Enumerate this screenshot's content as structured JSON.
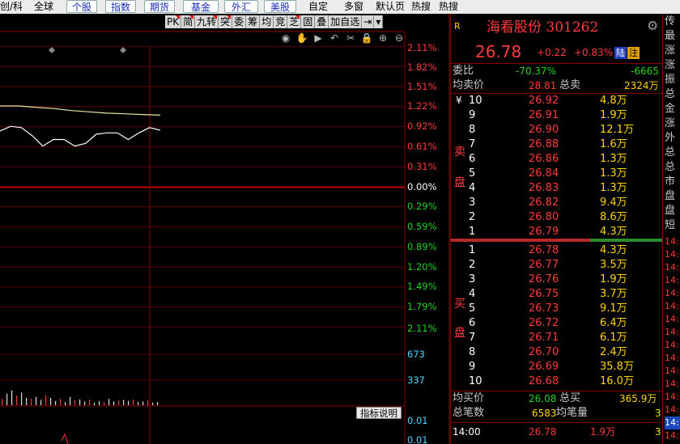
{
  "top_menu": {
    "items": [
      "创/科",
      "全球",
      "个股",
      "指数",
      "期货",
      "基金",
      "外汇",
      "美股",
      "自定",
      "多窗",
      "默认页",
      "热搜",
      "热搜"
    ],
    "buttons": [
      "个股",
      "指数",
      "期货",
      "基金",
      "外汇",
      "美股"
    ]
  },
  "chart_toolbar": [
    "PK",
    "简",
    "九转",
    "突",
    "委",
    "筹",
    "均",
    "竞",
    "芝",
    "固",
    "叠",
    "加自选",
    "⇥",
    "▾"
  ],
  "chart_tools": [
    "eye-icon",
    "hand-icon",
    "play-icon",
    "undo-icon",
    "scissors-icon",
    "lock-icon",
    "zoom-in-icon",
    "zoom-out-icon"
  ],
  "chart_data": {
    "type": "line",
    "price_axis_labels_up": [
      "2.11%",
      "1.82%",
      "1.51%",
      "1.22%",
      "0.92%",
      "0.61%",
      "0.31%"
    ],
    "price_axis_zero": "0.00%",
    "price_axis_labels_down": [
      "0.29%",
      "0.59%",
      "0.89%",
      "1.20%",
      "1.49%",
      "1.79%",
      "2.11%"
    ],
    "volume_labels": [
      "673",
      "337"
    ],
    "indicator_labels": [
      "0.01",
      "0.01"
    ],
    "indicator_button": "指标说明",
    "avg_line": [
      1.23,
      1.23,
      1.21,
      1.19,
      1.16,
      1.14,
      1.12,
      1.11,
      1.1,
      1.09
    ],
    "price_line": [
      0.85,
      0.92,
      0.9,
      0.78,
      0.62,
      0.72,
      0.72,
      0.62,
      0.66,
      0.8,
      0.82,
      0.82,
      0.72,
      0.82,
      0.9,
      0.86
    ],
    "volumes": [
      60,
      110,
      140,
      90,
      120,
      70,
      60,
      80,
      50,
      95,
      70,
      40,
      60,
      30,
      80,
      45,
      55,
      35,
      50,
      25,
      40,
      30,
      60,
      35,
      45,
      50,
      40,
      55,
      30,
      35,
      45,
      25,
      30
    ]
  },
  "quote": {
    "tag": "R",
    "name": "海看股份 301262",
    "price": "26.78",
    "change": "+0.22",
    "change_pct": "+0.83%",
    "badges": [
      "陆",
      "注"
    ],
    "weibi_label": "委比",
    "weibi_pct": "-70.37%",
    "weibi_diff": "-6665",
    "avg_sell_label": "均卖价",
    "avg_sell_price": "28.81",
    "total_sell_label": "总卖",
    "total_sell": "2324万",
    "currency": "¥",
    "sell_label": [
      "卖",
      "盘"
    ],
    "buy_label": [
      "买",
      "盘"
    ],
    "asks": [
      {
        "level": "10",
        "price": "26.92",
        "vol": "4.8万"
      },
      {
        "level": "9",
        "price": "26.91",
        "vol": "1.9万"
      },
      {
        "level": "8",
        "price": "26.90",
        "vol": "12.1万"
      },
      {
        "level": "7",
        "price": "26.88",
        "vol": "1.6万"
      },
      {
        "level": "6",
        "price": "26.86",
        "vol": "1.3万"
      },
      {
        "level": "5",
        "price": "26.84",
        "vol": "1.3万"
      },
      {
        "level": "4",
        "price": "26.83",
        "vol": "1.3万"
      },
      {
        "level": "3",
        "price": "26.82",
        "vol": "9.4万"
      },
      {
        "level": "2",
        "price": "26.80",
        "vol": "8.6万"
      },
      {
        "level": "1",
        "price": "26.79",
        "vol": "4.3万"
      }
    ],
    "bids": [
      {
        "level": "1",
        "price": "26.78",
        "vol": "4.3万"
      },
      {
        "level": "2",
        "price": "26.77",
        "vol": "3.5万"
      },
      {
        "level": "3",
        "price": "26.76",
        "vol": "1.9万"
      },
      {
        "level": "4",
        "price": "26.75",
        "vol": "3.7万"
      },
      {
        "level": "5",
        "price": "26.73",
        "vol": "9.1万"
      },
      {
        "level": "6",
        "price": "26.72",
        "vol": "6.4万"
      },
      {
        "level": "7",
        "price": "26.71",
        "vol": "6.1万"
      },
      {
        "level": "8",
        "price": "26.70",
        "vol": "2.4万"
      },
      {
        "level": "9",
        "price": "26.69",
        "vol": "35.8万"
      },
      {
        "level": "10",
        "price": "26.68",
        "vol": "16.0万"
      }
    ],
    "avg_buy_label": "均买价",
    "avg_buy_price": "26.08",
    "total_buy_label": "总买",
    "total_buy": "365.9万",
    "total_orders_label": "总笔数",
    "total_orders": "6583",
    "avg_lot_label": "均笔量",
    "avg_lot": "3",
    "tick": {
      "time": "14:00",
      "price": "26.78",
      "vol": "1.9万",
      "count": "3"
    }
  },
  "side_panel": {
    "labels": [
      "传",
      "最",
      "涨",
      "涨",
      "振",
      "总",
      "金",
      "涨",
      "外",
      "总",
      "总",
      "市",
      "盘",
      "盘",
      "短"
    ],
    "times": [
      "14:",
      "14:",
      "14:",
      "14:",
      "14:",
      "14:",
      "14:",
      "14:",
      "14:",
      "14:",
      "14:",
      "14:",
      "14:",
      "14:",
      "14:",
      "14:"
    ],
    "selected_time": "14:"
  }
}
